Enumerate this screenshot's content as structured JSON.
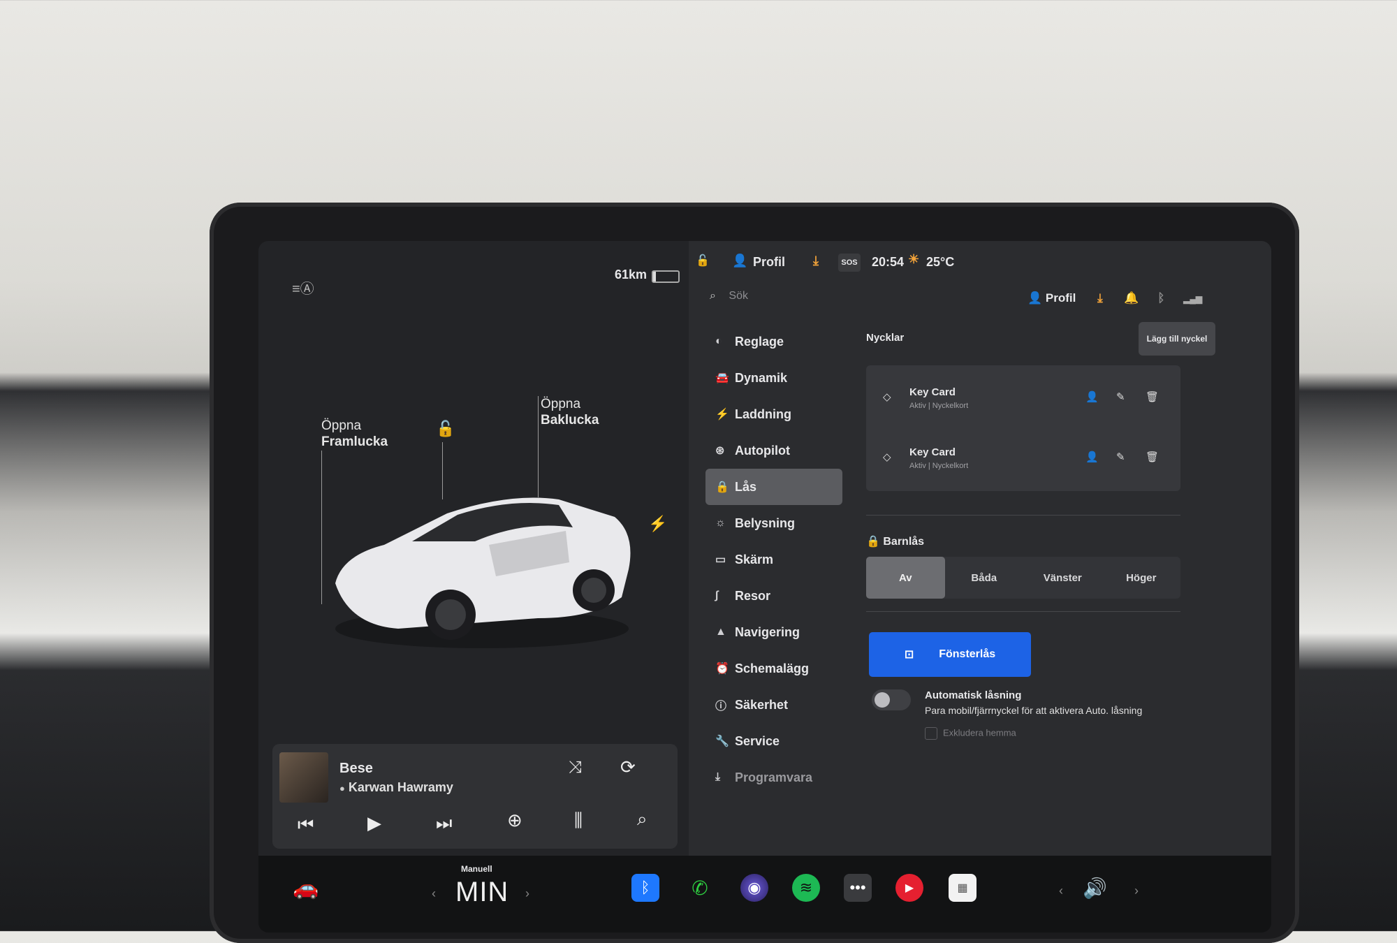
{
  "car": {
    "range": "61km",
    "front_trunk_l1": "Öppna",
    "front_trunk_l2": "Framlucka",
    "rear_trunk_l1": "Öppna",
    "rear_trunk_l2": "Baklucka"
  },
  "media": {
    "song": "Bese",
    "artist": "Karwan Hawramy"
  },
  "status": {
    "profile": "Profil",
    "time": "20:54",
    "temp": "25°C",
    "sos": "SOS"
  },
  "search": {
    "placeholder": "Sök",
    "profile": "Profil"
  },
  "menu": {
    "items": [
      {
        "label": "Reglage",
        "icon": "toggle-icon"
      },
      {
        "label": "Dynamik",
        "icon": "car-icon"
      },
      {
        "label": "Laddning",
        "icon": "bolt-icon"
      },
      {
        "label": "Autopilot",
        "icon": "steering-wheel-icon"
      },
      {
        "label": "Lås",
        "icon": "lock-icon"
      },
      {
        "label": "Belysning",
        "icon": "sun-icon"
      },
      {
        "label": "Skärm",
        "icon": "display-icon"
      },
      {
        "label": "Resor",
        "icon": "route-icon"
      },
      {
        "label": "Navigering",
        "icon": "navigation-icon"
      },
      {
        "label": "Schemalägg",
        "icon": "clock-icon"
      },
      {
        "label": "Säkerhet",
        "icon": "info-icon"
      },
      {
        "label": "Service",
        "icon": "wrench-icon"
      },
      {
        "label": "Programvara",
        "icon": "download-icon"
      }
    ],
    "active": "Lås"
  },
  "keys": {
    "heading": "Nycklar",
    "add_button": "Lägg till nyckel",
    "items": [
      {
        "name": "Key Card",
        "sub": "Aktiv | Nyckelkort"
      },
      {
        "name": "Key Card",
        "sub": "Aktiv | Nyckelkort"
      }
    ]
  },
  "childlock": {
    "heading": "Barnlås",
    "options": [
      "Av",
      "Båda",
      "Vänster",
      "Höger"
    ],
    "selected": "Av"
  },
  "window_lock": {
    "label": "Fönsterlås"
  },
  "auto_lock": {
    "title": "Automatisk låsning",
    "subtitle": "Para mobil/fjärrnyckel för att aktivera Auto. låsning",
    "exclude": "Exkludera hemma",
    "enabled": false
  },
  "dock": {
    "mode_label": "Manuell",
    "mode_value": "MIN"
  },
  "colors": {
    "accent": "#1d63e6",
    "spotify": "#1db954",
    "phone": "#2ecc40",
    "alert_orange": "#f2a33a"
  }
}
